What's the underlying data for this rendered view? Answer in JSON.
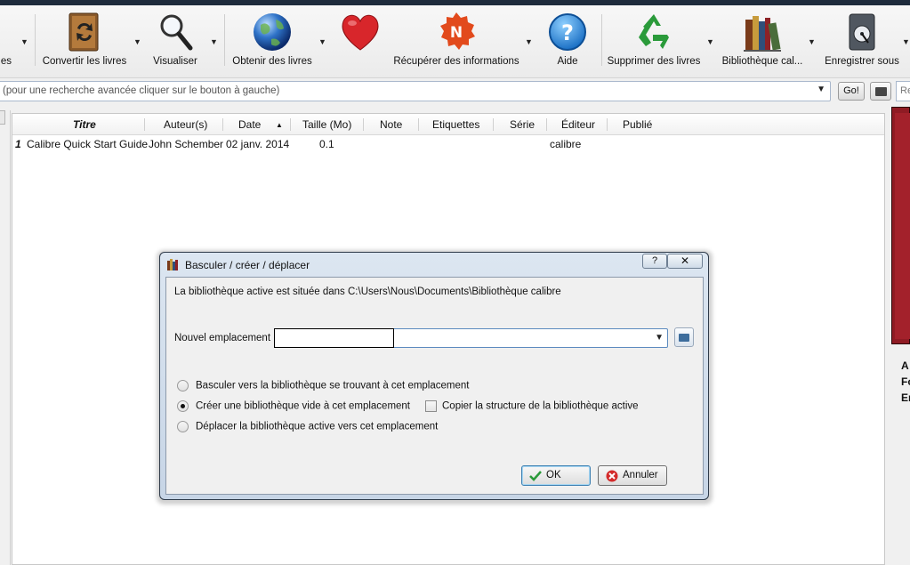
{
  "toolbar": {
    "partial_left_label": "es",
    "convert_label": "Convertir les livres",
    "view_label": "Visualiser",
    "get_books_label": "Obtenir des livres",
    "fetch_news_label": "Récupérer des informations",
    "help_label": "Aide",
    "remove_label": "Supprimer des livres",
    "library_label": "Bibliothèque cal...",
    "save_label": "Enregistrer sous"
  },
  "search": {
    "placeholder": "(pour une recherche avancée cliquer sur le bouton à gauche)",
    "go_label": "Go!",
    "saved_search_partial": "Re"
  },
  "book_list": {
    "columns": [
      "Titre",
      "Auteur(s)",
      "Date",
      "Taille (Mo)",
      "Note",
      "Etiquettes",
      "Série",
      "Éditeur",
      "Publié"
    ],
    "sort_indicator": "▲",
    "rows": [
      {
        "index": "1",
        "title": "Calibre Quick Start Guide",
        "author": "John Schember",
        "date": "02 janv. 2014",
        "size": "0.1",
        "publisher": "calibre"
      }
    ]
  },
  "details_partial": [
    "A",
    "Fo",
    "En"
  ],
  "dialog": {
    "title": "Basculer / créer / déplacer",
    "help_button": "?",
    "close_button": "✕",
    "info": "La bibliothèque active est située dans C:\\Users\\Nous\\Documents\\Bibliothèque calibre",
    "location_label": "Nouvel emplacement :",
    "location_value": "",
    "options": [
      {
        "label": "Basculer vers la bibliothèque se trouvant à cet emplacement",
        "selected": false
      },
      {
        "label": "Créer une bibliothèque vide à cet emplacement",
        "selected": true
      },
      {
        "label": "Déplacer la bibliothèque active vers cet emplacement",
        "selected": false
      }
    ],
    "copy_structure_label": "Copier la structure de la bibliothèque active",
    "copy_structure_checked": false,
    "ok_label": "OK",
    "cancel_label": "Annuler"
  },
  "colors": {
    "dialog_frame": "#c7d5e6",
    "cover": "#8f1b24",
    "heart": "#d8262b",
    "recycle": "#2a9a3a"
  }
}
